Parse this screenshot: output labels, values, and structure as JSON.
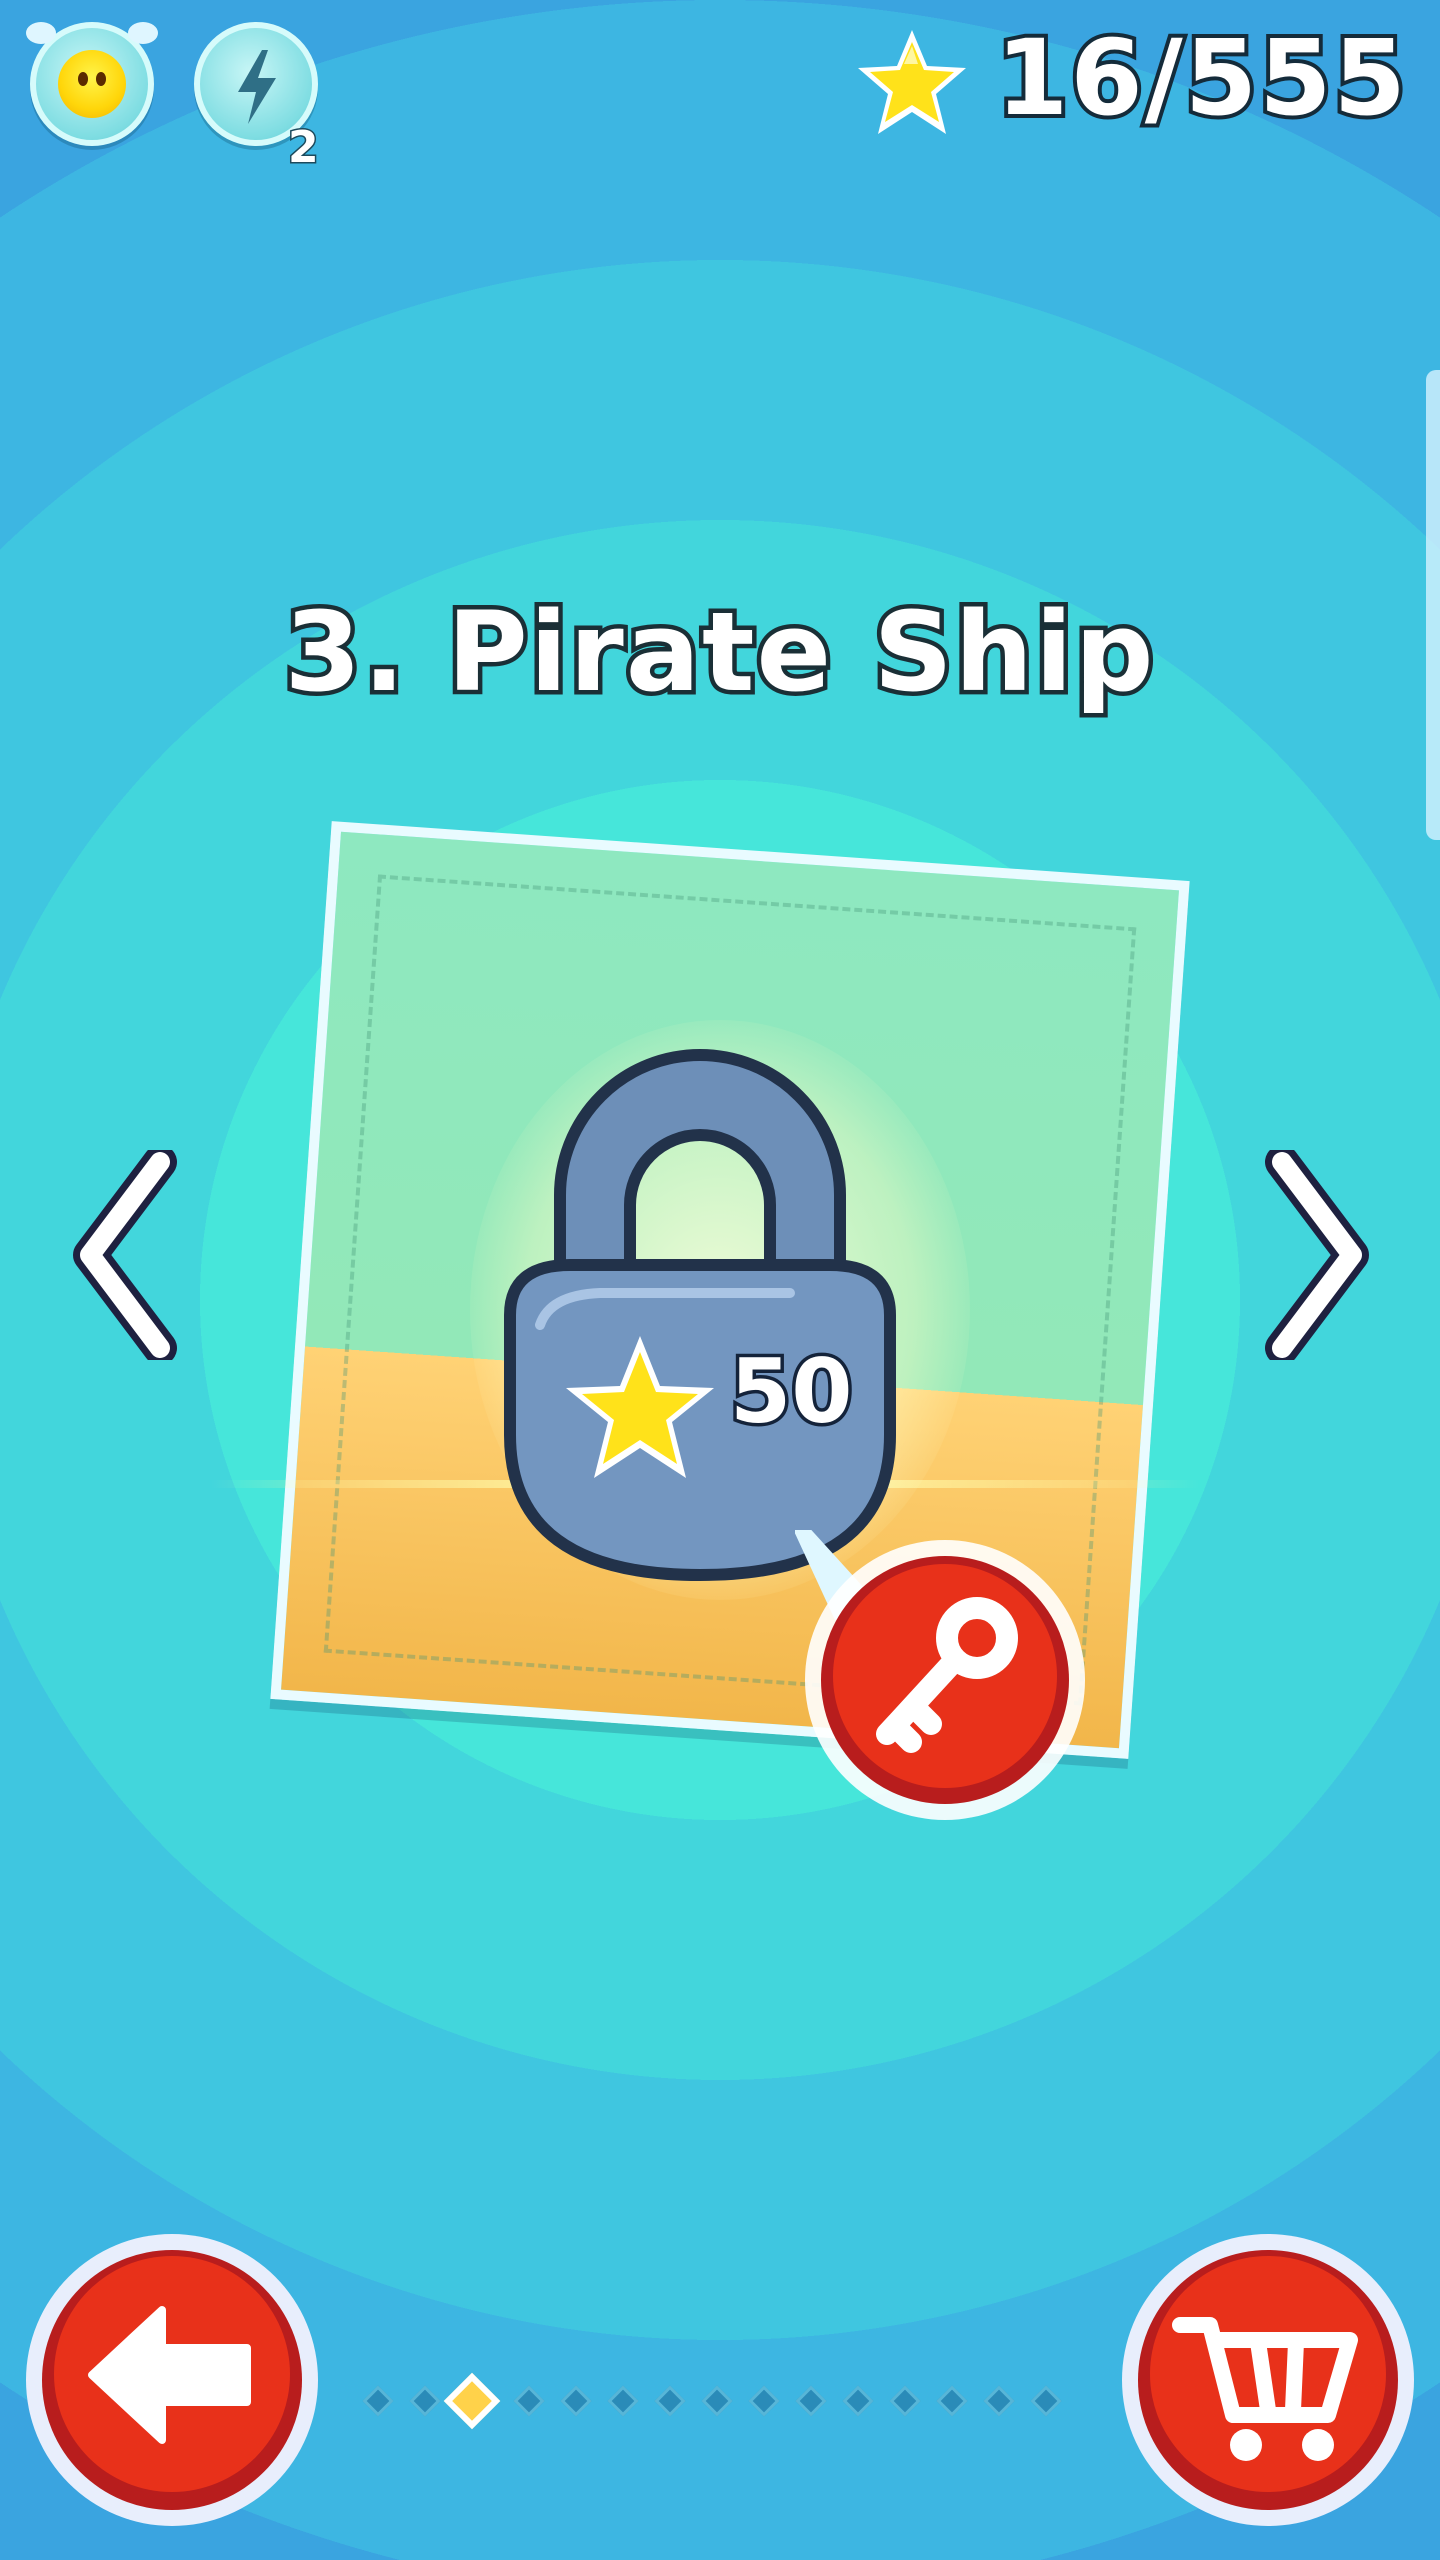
{
  "hud": {
    "energy_count": "2",
    "stars_collected": "16/555"
  },
  "level": {
    "title": "3. Pirate Ship",
    "unlock_cost": "50",
    "locked": true
  },
  "pagination": {
    "total_pages": 15,
    "current_page": 3
  },
  "colors": {
    "background": "#3fd0d6",
    "button_red": "#e8311a",
    "lock_blue": "#6d8fb8",
    "star_yellow": "#ffe21a"
  },
  "icons": [
    "monster-icon",
    "lightning-icon",
    "star-icon",
    "lock-icon",
    "key-icon",
    "chevron-left-icon",
    "chevron-right-icon",
    "arrow-left-icon",
    "cart-icon"
  ]
}
